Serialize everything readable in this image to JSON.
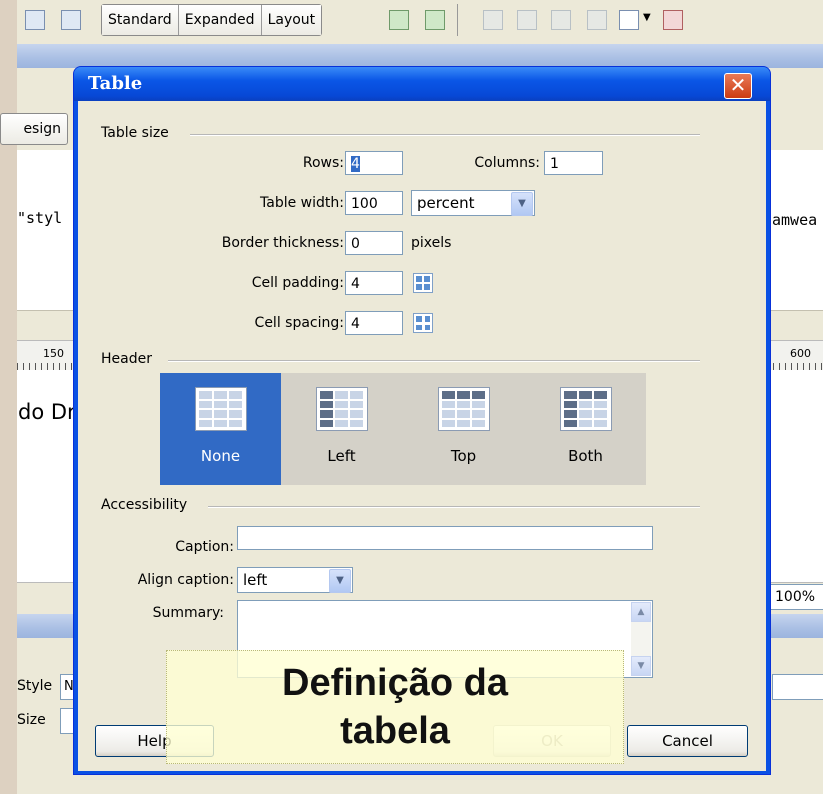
{
  "app": {
    "view_buttons": [
      "Standard",
      "Expanded",
      "Layout"
    ],
    "design_tab_label": "esign",
    "code_left_text": "\"styl",
    "code_right_text": "amwea",
    "ruler_left_label": "150",
    "ruler_right_label": "600",
    "content_text": "do Dr",
    "zoom_value": "100%",
    "prop_style_label": "Style",
    "prop_style_value": "N",
    "prop_size_label": "Size"
  },
  "dialog": {
    "title": "Table",
    "close_glyph": "✕",
    "table_size": {
      "section_label": "Table size",
      "rows_label": "Rows:",
      "rows_value": "4",
      "columns_label": "Columns:",
      "columns_value": "1",
      "width_label": "Table width:",
      "width_value": "100",
      "width_unit": "percent",
      "border_label": "Border thickness:",
      "border_value": "0",
      "border_unit": "pixels",
      "padding_label": "Cell padding:",
      "padding_value": "4",
      "spacing_label": "Cell spacing:",
      "spacing_value": "4"
    },
    "header": {
      "section_label": "Header",
      "options": [
        "None",
        "Left",
        "Top",
        "Both"
      ],
      "selected": "None"
    },
    "accessibility": {
      "section_label": "Accessibility",
      "caption_label": "Caption:",
      "caption_value": "",
      "align_label": "Align caption:",
      "align_value": "left",
      "summary_label": "Summary:",
      "summary_value": ""
    },
    "buttons": {
      "help": "Help",
      "ok": "OK",
      "cancel": "Cancel"
    }
  },
  "overlay_caption": {
    "line1": "Definição da",
    "line2": "tabela"
  },
  "colors": {
    "title_bar": "#0a56e6",
    "selected_header": "#316ac5",
    "close_button": "#d6461c"
  }
}
